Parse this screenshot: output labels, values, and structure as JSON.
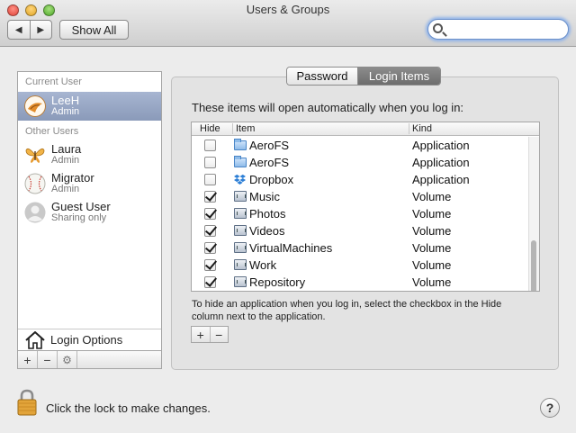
{
  "window": {
    "title": "Users & Groups"
  },
  "toolbar": {
    "back_glyph": "◀",
    "forward_glyph": "▶",
    "show_all_label": "Show All",
    "search_value": ""
  },
  "sidebar": {
    "current_user_header": "Current User",
    "other_users_header": "Other Users",
    "current_user": {
      "name": "LeeH",
      "role": "Admin",
      "icon": "flower-avatar-icon"
    },
    "other_users": [
      {
        "name": "Laura",
        "role": "Admin",
        "icon": "butterfly-avatar-icon"
      },
      {
        "name": "Migrator",
        "role": "Admin",
        "icon": "baseball-avatar-icon"
      },
      {
        "name": "Guest User",
        "role": "Sharing only",
        "icon": "guest-silhouette-icon"
      }
    ],
    "login_options_label": "Login Options",
    "add_glyph": "+",
    "remove_glyph": "−",
    "gear_glyph": "⚙"
  },
  "tabs": {
    "password_label": "Password",
    "login_items_label": "Login Items",
    "selected": "Login Items"
  },
  "login_items": {
    "heading": "These items will open automatically when you log in:",
    "columns": {
      "hide": "Hide",
      "item": "Item",
      "kind": "Kind"
    },
    "rows": [
      {
        "hide": false,
        "name": "AeroFS",
        "kind": "Application",
        "icon": "folder-icon"
      },
      {
        "hide": false,
        "name": "AeroFS",
        "kind": "Application",
        "icon": "folder-icon"
      },
      {
        "hide": false,
        "name": "Dropbox",
        "kind": "Application",
        "icon": "dropbox-icon"
      },
      {
        "hide": true,
        "name": "Music",
        "kind": "Volume",
        "icon": "volume-icon"
      },
      {
        "hide": true,
        "name": "Photos",
        "kind": "Volume",
        "icon": "volume-icon"
      },
      {
        "hide": true,
        "name": "Videos",
        "kind": "Volume",
        "icon": "volume-icon"
      },
      {
        "hide": true,
        "name": "VirtualMachines",
        "kind": "Volume",
        "icon": "volume-icon"
      },
      {
        "hide": true,
        "name": "Work",
        "kind": "Volume",
        "icon": "volume-icon"
      },
      {
        "hide": true,
        "name": "Repository",
        "kind": "Volume",
        "icon": "volume-icon"
      }
    ],
    "hint_line1": "To hide an application when you log in, select the checkbox in the Hide",
    "hint_line2": "column next to the application.",
    "add_glyph": "+",
    "remove_glyph": "−"
  },
  "footer": {
    "lock_text": "Click the lock to make changes.",
    "help_glyph": "?"
  },
  "colors": {
    "selection": "#8a9ab9",
    "search_focus": "#8fb3ea"
  }
}
